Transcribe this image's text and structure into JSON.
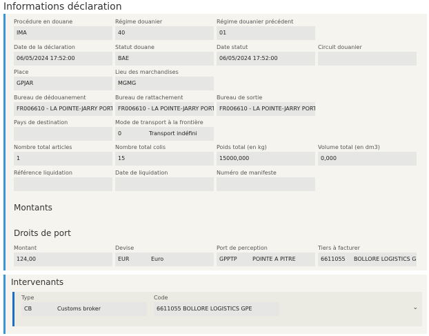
{
  "title": "Informations déclaration",
  "fields": {
    "procedure": {
      "label": "Procédure en douane",
      "value": "IMA"
    },
    "regime": {
      "label": "Régime douanier",
      "value": "40"
    },
    "regime_prec": {
      "label": "Régime douanier précédent",
      "value": "01"
    },
    "date_decl": {
      "label": "Date de la déclaration",
      "value": "06/05/2024 17:52:00"
    },
    "statut": {
      "label": "Statut douane",
      "value": "BAE"
    },
    "date_statut": {
      "label": "Date statut",
      "value": "06/05/2024 17:52:00"
    },
    "circuit": {
      "label": "Circuit douanier",
      "value": ""
    },
    "place": {
      "label": "Place",
      "value": "GPJAR"
    },
    "lieu": {
      "label": "Lieu des marchandises",
      "value": "MGMG"
    },
    "bureau_dedouanement": {
      "label": "Bureau de dédouanement",
      "value": "FR006610  -  LA POINTE-JARRY PORT"
    },
    "bureau_rattachement": {
      "label": "Bureau de rattachement",
      "value": "FR006610  -  LA POINTE-JARRY PORT"
    },
    "bureau_sortie": {
      "label": "Bureau de sortie",
      "value": "FR006610  -  LA POINTE-JARRY PORT"
    },
    "pays_dest": {
      "label": "Pays de destination",
      "value": ""
    },
    "mode_transport": {
      "label": "Mode de transport à la frontière",
      "code": "0",
      "desc": "Transport indéfini"
    },
    "nb_articles": {
      "label": "Nombre total articles",
      "value": "1"
    },
    "nb_colis": {
      "label": "Nombre total colis",
      "value": "15"
    },
    "poids": {
      "label": "Poids total (en kg)",
      "value": "15000,000"
    },
    "volume": {
      "label": "Volume total (en dm3)",
      "value": "0,000"
    },
    "ref_liq": {
      "label": "Référence liquidation",
      "value": ""
    },
    "date_liq": {
      "label": "Date de liquidation",
      "value": ""
    },
    "manifeste": {
      "label": "Numéro de manifeste",
      "value": ""
    }
  },
  "montants": {
    "heading": "Montants"
  },
  "droits": {
    "heading": "Droits de port",
    "montant": {
      "label": "Montant",
      "value": "124,00"
    },
    "devise": {
      "label": "Devise",
      "code": "EUR",
      "desc": "Euro"
    },
    "port": {
      "label": "Port de perception",
      "code": "GPPTP",
      "desc": "POINTE A PITRE"
    },
    "tiers": {
      "label": "Tiers à facturer",
      "code": "6611055",
      "desc": "BOLLORE LOGISTICS GPE"
    }
  },
  "intervenants": {
    "heading": "Intervenants",
    "type": {
      "label": "Type",
      "code": "CB",
      "desc": "Customs broker"
    },
    "code": {
      "label": "Code",
      "value": "6611055 BOLLORE LOGISTICS GPE"
    }
  },
  "colors": {
    "accent": "#3a95d8",
    "inner_accent": "#1a6fc0",
    "field_bg": "#e6e6e4",
    "section_bg": "#f5f4ee"
  }
}
